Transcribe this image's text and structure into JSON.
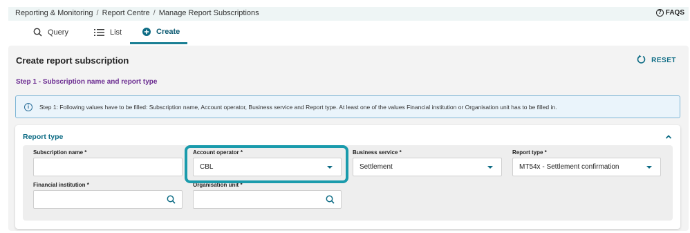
{
  "breadcrumb": {
    "items": [
      "Reporting & Monitoring",
      "Report Centre",
      "Manage Report Subscriptions"
    ],
    "separator": "/"
  },
  "header": {
    "faqs_label": "FAQS"
  },
  "tabs": [
    {
      "label": "Query",
      "icon": "search-icon"
    },
    {
      "label": "List",
      "icon": "list-icon"
    },
    {
      "label": "Create",
      "icon": "plus-circle-icon",
      "active": true
    }
  ],
  "page": {
    "title": "Create report subscription",
    "reset_label": "RESET",
    "step_title": "Step 1 - Subscription name and report type",
    "info_text": "Step 1: Following values have to be filled: Subscription name, Account operator, Business service and Report type. At least one of the values Financial institution or Organisation unit has to be filled in."
  },
  "card": {
    "title": "Report type",
    "fields": {
      "subscription_name": {
        "label": "Subscription name *",
        "value": ""
      },
      "account_operator": {
        "label": "Account operator *",
        "value": "CBL"
      },
      "business_service": {
        "label": "Business service *",
        "value": "Settlement"
      },
      "report_type": {
        "label": "Report type *",
        "value": "MT54x - Settlement confirmation"
      },
      "financial_institution": {
        "label": "Financial institution *",
        "value": ""
      },
      "organisation_unit": {
        "label": "Organisation unit *",
        "value": ""
      }
    }
  },
  "colors": {
    "accent": "#0c6b84",
    "step_purple": "#6b2c91",
    "highlight": "#1a9bac",
    "info_bg": "#eaf4fb"
  }
}
